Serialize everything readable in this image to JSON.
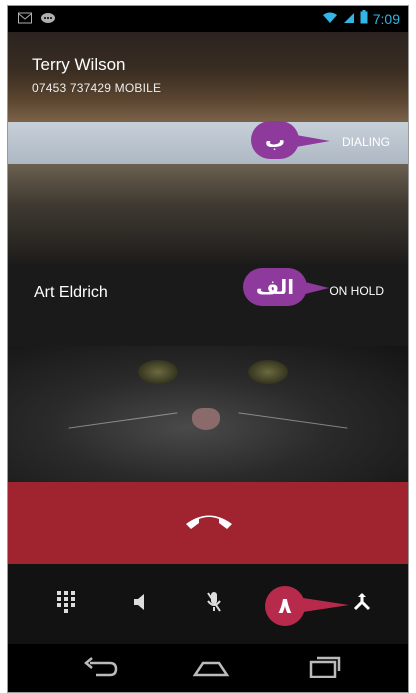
{
  "status_bar": {
    "time": "7:09",
    "left_icons": [
      "mail-icon",
      "chat-icon"
    ],
    "right_icons": [
      "wifi-icon",
      "signal-icon",
      "battery-icon"
    ]
  },
  "calls": {
    "active": {
      "name": "Terry Wilson",
      "number_line": "07453 737429  MOBILE",
      "status": "DIALING"
    },
    "held": {
      "name": "Art Eldrich",
      "status": "ON HOLD"
    }
  },
  "annotations": {
    "dialing_label": "ب",
    "hold_label": "الف",
    "merge_label": "۸"
  },
  "controls": [
    {
      "name": "dialpad-button",
      "icon": "dialpad-icon"
    },
    {
      "name": "speaker-button",
      "icon": "speaker-icon"
    },
    {
      "name": "mute-button",
      "icon": "mute-mic-icon"
    },
    {
      "name": "merge-button",
      "icon": "merge-call-icon"
    }
  ],
  "nav": [
    "back-icon",
    "home-icon",
    "recents-icon"
  ],
  "colors": {
    "end_call_bar": "#a0242f",
    "callout_purple": "#8e3a9d",
    "callout_red": "#b82a4b",
    "status_accent": "#33b5e5"
  }
}
